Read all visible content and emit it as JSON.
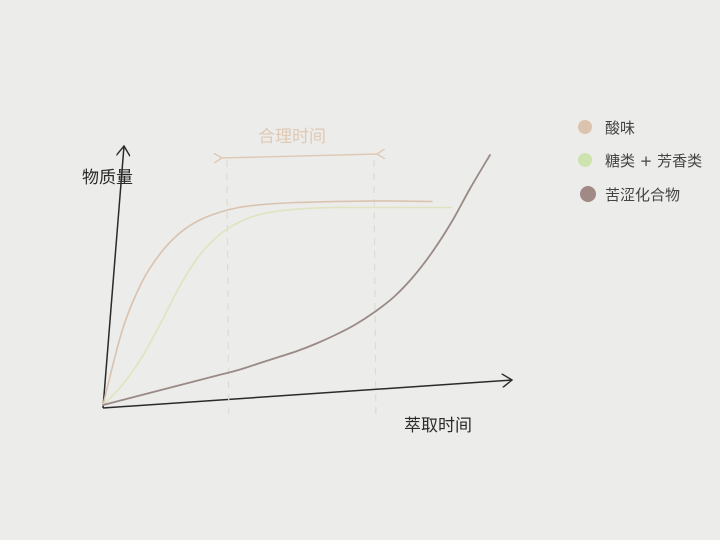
{
  "chart_data": {
    "type": "line",
    "title": "",
    "xlabel": "萃取时间",
    "ylabel": "物质量",
    "annotation": "合理时间",
    "grid": false,
    "legend_position": "top-right",
    "x": [
      0,
      0.05,
      0.1,
      0.15,
      0.2,
      0.25,
      0.3,
      0.35,
      0.4,
      0.45,
      0.5,
      0.55,
      0.6,
      0.65,
      0.7,
      0.75,
      0.8,
      0.85,
      0.9,
      0.95,
      1.0
    ],
    "xlim": [
      0,
      1.0
    ],
    "ylim": [
      0,
      1.0
    ],
    "reasonable_window": [
      0.32,
      0.7
    ],
    "series": [
      {
        "name": "酸味",
        "color": "#d9c2ae",
        "values": [
          0.0,
          0.3,
          0.49,
          0.61,
          0.69,
          0.74,
          0.77,
          0.79,
          0.8,
          0.806,
          0.81,
          0.812,
          0.814,
          0.815,
          0.816,
          0.816,
          0.815,
          0.814,
          null,
          null,
          null
        ]
      },
      {
        "name": "糖类 + 芳香类",
        "color": "#e0e3bf",
        "values": [
          0.0,
          0.08,
          0.19,
          0.33,
          0.48,
          0.6,
          0.68,
          0.73,
          0.76,
          0.775,
          0.783,
          0.788,
          0.79,
          0.79,
          0.79,
          0.79,
          0.79,
          0.79,
          0.79,
          null,
          null
        ]
      },
      {
        "name": "苦涩化合物",
        "color": "#9a8a86",
        "values": [
          0.0,
          0.02,
          0.04,
          0.06,
          0.08,
          0.1,
          0.12,
          0.14,
          0.165,
          0.19,
          0.215,
          0.245,
          0.28,
          0.32,
          0.37,
          0.43,
          0.51,
          0.61,
          0.73,
          0.87,
          1.0
        ]
      }
    ]
  }
}
